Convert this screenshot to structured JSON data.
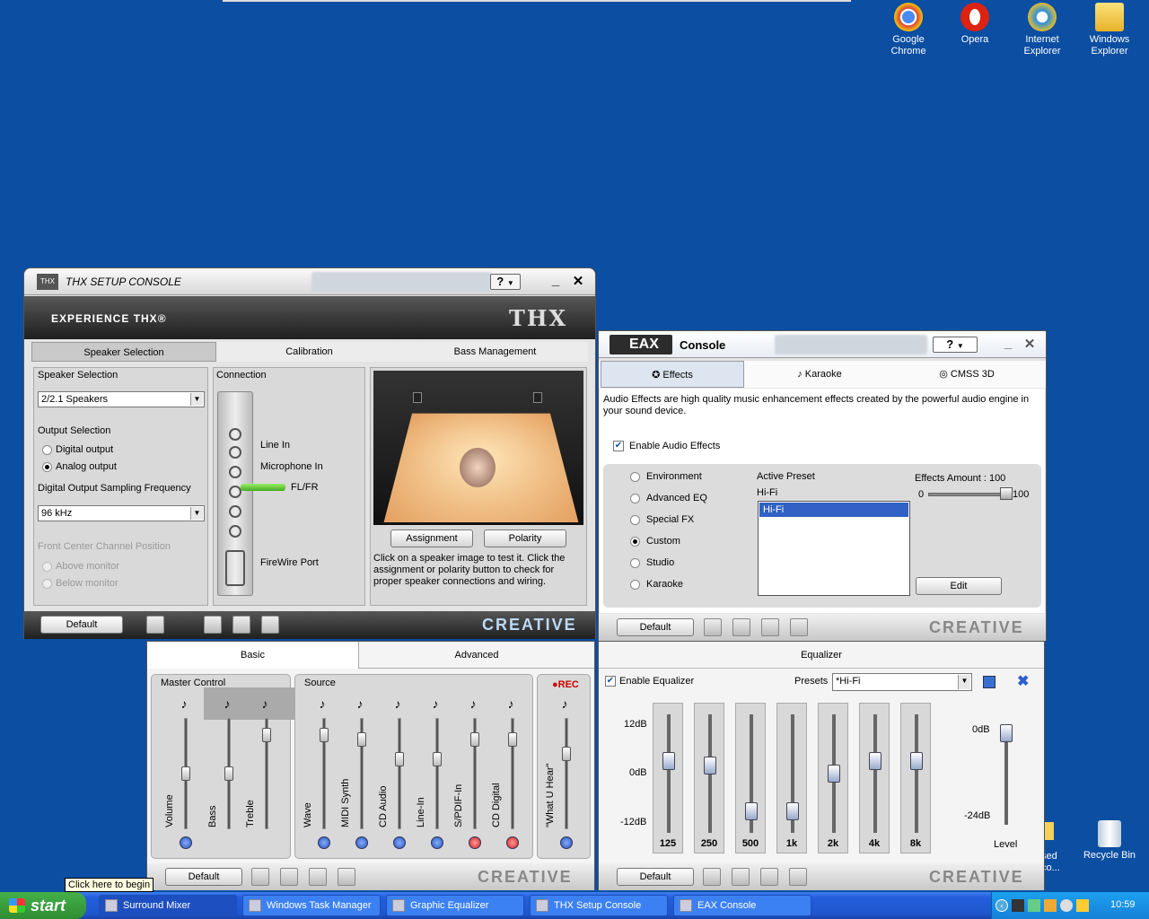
{
  "desktop": {
    "icons": [
      {
        "label": "Google\nChrome",
        "name": "chrome"
      },
      {
        "label": "Opera",
        "name": "opera"
      },
      {
        "label": "Internet\nExplorer",
        "name": "ie"
      },
      {
        "label": "Windows\nExplorer",
        "name": "explorer"
      }
    ],
    "partial_icon_label": "sed\nco...",
    "recycle_bin": "Recycle Bin"
  },
  "thx": {
    "title": "THX SETUP CONSOLE",
    "help_label": "?",
    "banner": "EXPERIENCE THX®",
    "thx_logo": "THX",
    "tabs": [
      "Speaker Selection",
      "Calibration",
      "Bass Management"
    ],
    "speaker_selection_label": "Speaker Selection",
    "speaker_value": "2/2.1 Speakers",
    "output_selection_label": "Output Selection",
    "digital_output": "Digital output",
    "analog_output": "Analog output",
    "sampling_label": "Digital Output Sampling Frequency",
    "sampling_value": "96 kHz",
    "front_center_label": "Front Center Channel Position",
    "above_monitor": "Above monitor",
    "below_monitor": "Below monitor",
    "connection_label": "Connection",
    "line_in": "Line In",
    "mic_in": "Microphone In",
    "fl_fr": "FL/FR",
    "firewire": "FireWire Port",
    "assignment": "Assignment",
    "polarity": "Polarity",
    "instructions": "Click on a speaker image to test it. Click the assignment or polarity button to check for proper speaker connections and wiring.",
    "default": "Default",
    "creative": "CREATIVE"
  },
  "eax": {
    "title": "Console",
    "eax_logo": "EAX",
    "help_label": "?",
    "tabs": [
      "Effects",
      "Karaoke",
      "CMSS 3D"
    ],
    "description": "Audio Effects are high quality music enhancement effects created by the powerful audio engine in your sound device.",
    "enable_label": "Enable Audio Effects",
    "options": [
      "Environment",
      "Advanced EQ",
      "Special FX",
      "Custom",
      "Studio",
      "Karaoke"
    ],
    "selected_option": "Custom",
    "active_preset_label": "Active Preset",
    "active_preset": "Hi-Fi",
    "preset_list": [
      "Hi-Fi"
    ],
    "effects_amount_label": "Effects Amount : 100",
    "amount_min": "0",
    "amount_max": "100",
    "amount_value": 100,
    "edit": "Edit",
    "default": "Default",
    "creative": "CREATIVE"
  },
  "mixer": {
    "tabs": [
      "Basic",
      "Advanced"
    ],
    "master_label": "Master Control",
    "source_label": "Source",
    "rec_label": "●REC",
    "master_channels": [
      {
        "label": "Volume",
        "level": 0.5
      },
      {
        "label": "Bass",
        "level": 0.5
      },
      {
        "label": "Treble",
        "level": 0.9
      }
    ],
    "source_channels": [
      {
        "label": "Wave",
        "level": 0.9,
        "muted": false
      },
      {
        "label": "MIDI Synth",
        "level": 0.85,
        "muted": false
      },
      {
        "label": "CD Audio",
        "level": 0.65,
        "muted": false
      },
      {
        "label": "Line-In",
        "level": 0.65,
        "muted": false
      },
      {
        "label": "S/PDIF-In",
        "level": 0.85,
        "muted": true
      },
      {
        "label": "CD Digital",
        "level": 0.85,
        "muted": true
      }
    ],
    "rec_channel": {
      "label": "\"What U Hear\"",
      "level": 0.7
    },
    "default": "Default",
    "creative": "CREATIVE"
  },
  "equalizer": {
    "title": "Equalizer",
    "enable_label": "Enable Equalizer",
    "presets_label": "Presets",
    "preset_value": "*Hi-Fi",
    "scale": [
      "12dB",
      "0dB",
      "-12dB"
    ],
    "bands": [
      {
        "label": "125",
        "db": 3
      },
      {
        "label": "250",
        "db": 2
      },
      {
        "label": "500",
        "db": -9
      },
      {
        "label": "1k",
        "db": -9
      },
      {
        "label": "2k",
        "db": 0
      },
      {
        "label": "4k",
        "db": 3
      },
      {
        "label": "8k",
        "db": 3
      }
    ],
    "level_scale": [
      "0dB",
      "-24dB"
    ],
    "level_label": "Level",
    "level_db": 0,
    "default": "Default",
    "creative": "CREATIVE"
  },
  "taskbar": {
    "start": "start",
    "tasks": [
      "Surround Mixer",
      "Windows Task Manager",
      "Graphic Equalizer",
      "THX Setup Console",
      "EAX Console"
    ],
    "clock": "10:59",
    "tooltip": "Click here to begin"
  }
}
